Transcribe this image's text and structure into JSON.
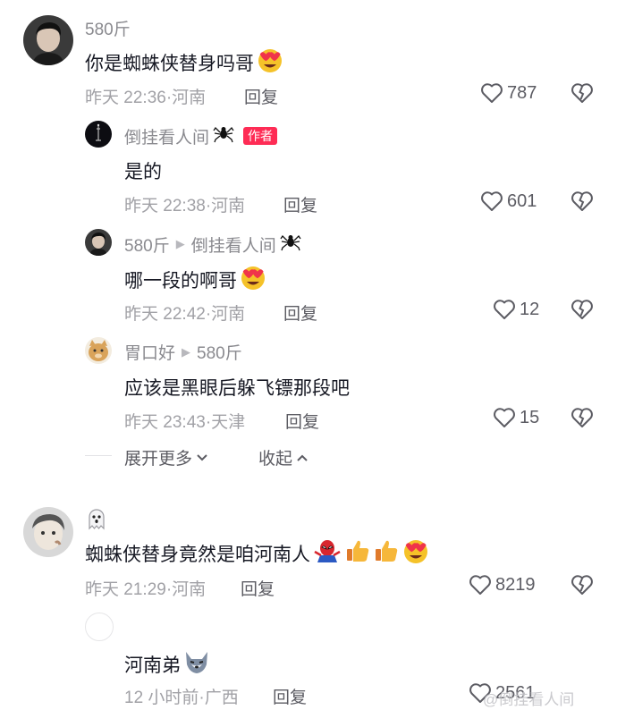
{
  "comments": [
    {
      "user": "580斤",
      "text": "你是蜘蛛侠替身吗哥",
      "time": "昨天 22:36",
      "location": "河南",
      "reply_label": "回复",
      "likes": "787",
      "replies": [
        {
          "user": "倒挂看人间",
          "badge": "作者",
          "text": "是的",
          "time": "昨天 22:38",
          "location": "河南",
          "reply_label": "回复",
          "likes": "601"
        },
        {
          "user": "580斤",
          "reply_to": "倒挂看人间",
          "text": "哪一段的啊哥",
          "time": "昨天 22:42",
          "location": "河南",
          "reply_label": "回复",
          "likes": "12"
        },
        {
          "user": "胃口好",
          "reply_to": "580斤",
          "text": "应该是黑眼后躲飞镖那段吧",
          "time": "昨天 23:43",
          "location": "天津",
          "reply_label": "回复",
          "likes": "15"
        }
      ],
      "expand_more": "展开更多",
      "collapse": "收起"
    },
    {
      "user_icon": "ghost-emoji",
      "text": "蜘蛛侠替身竟然是咱河南人",
      "time": "昨天 21:29",
      "location": "河南",
      "reply_label": "回复",
      "likes": "8219",
      "replies": [
        {
          "text": "河南弟",
          "time": "12 小时前",
          "location": "广西",
          "reply_label": "回复",
          "likes": "2561"
        }
      ]
    }
  ],
  "separator": "·",
  "watermark": "@倒挂看人间",
  "colors": {
    "author_badge": "#fe2c55",
    "secondary_text": "#a1a1a6"
  }
}
